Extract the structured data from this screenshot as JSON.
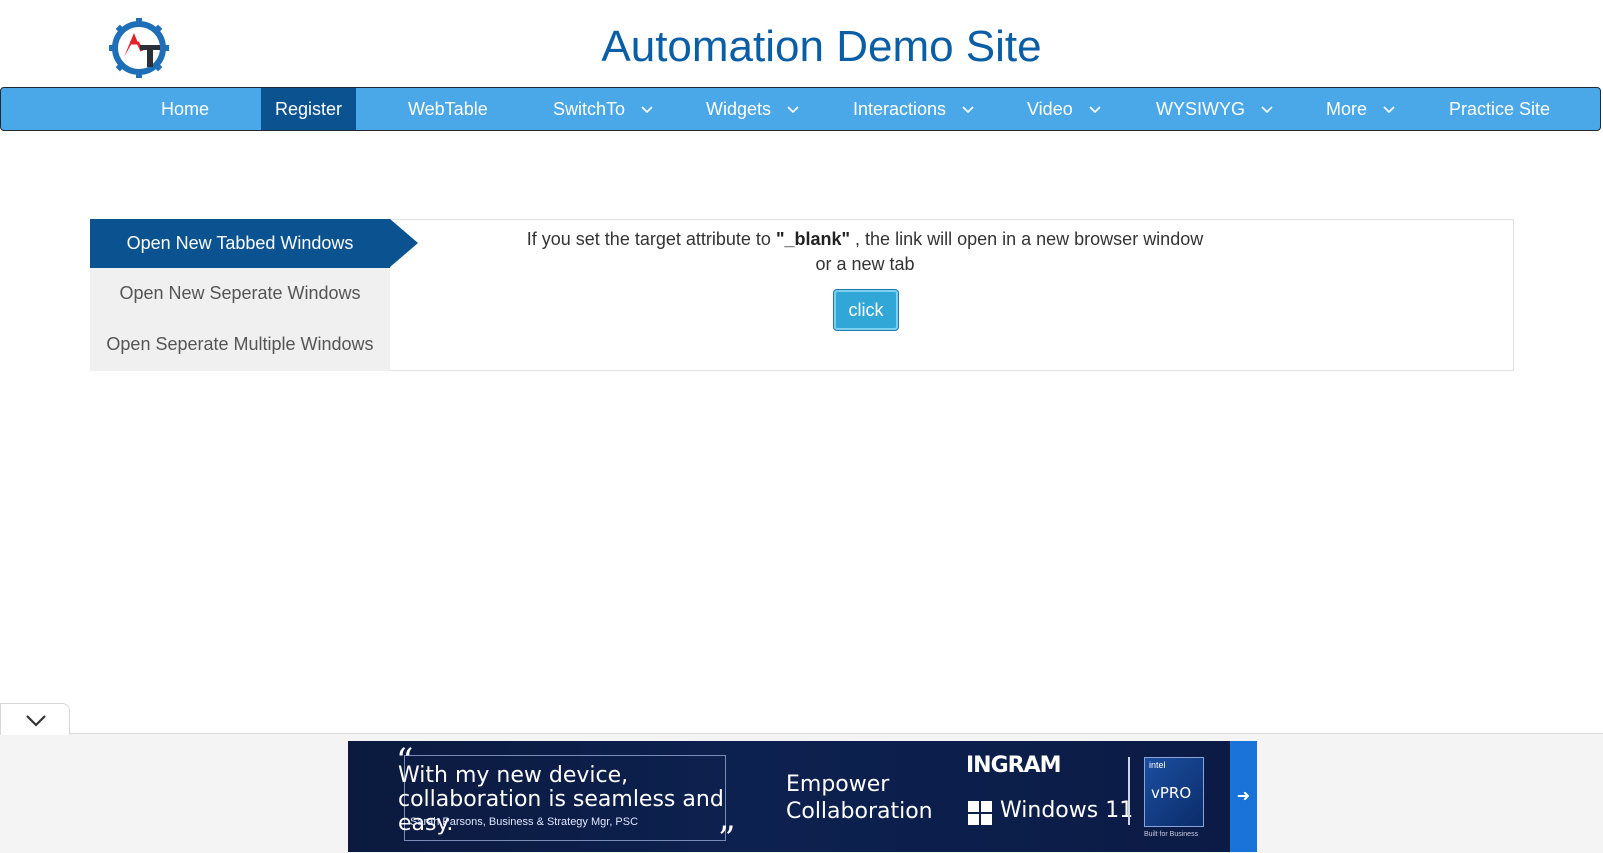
{
  "header": {
    "title": "Automation Demo Site",
    "logo_icon": "gear-logo-icon"
  },
  "nav": {
    "items": [
      {
        "label": "Home",
        "dropdown": false
      },
      {
        "label": "Register",
        "dropdown": false,
        "active": true
      },
      {
        "label": "WebTable",
        "dropdown": false
      },
      {
        "label": "SwitchTo",
        "dropdown": true
      },
      {
        "label": "Widgets",
        "dropdown": true
      },
      {
        "label": "Interactions",
        "dropdown": true
      },
      {
        "label": "Video",
        "dropdown": true
      },
      {
        "label": "WYSIWYG",
        "dropdown": true
      },
      {
        "label": "More",
        "dropdown": true
      },
      {
        "label": "Practice Site",
        "dropdown": false
      }
    ]
  },
  "tabs": {
    "items": [
      {
        "label": "Open New Tabbed Windows",
        "active": true
      },
      {
        "label": "Open New Seperate Windows"
      },
      {
        "label": "Open Seperate Multiple Windows"
      }
    ]
  },
  "content": {
    "desc_before": "If you set the target attribute to",
    "desc_bold": "\"_blank\"",
    "desc_after": ", the link will open in a new browser window or a new tab",
    "button_label": "click"
  },
  "ad": {
    "quote": "With my new device, collaboration is seamless and easy.",
    "attribution": "Sarah Parsons, Business & Strategy Mgr, PSC",
    "headline_line1": "Empower",
    "headline_line2": "Collaboration",
    "brand1": "INGRAM",
    "brand2": "Windows 11",
    "badge_top": "intel",
    "badge_main": "vPRO",
    "badge_bottom": "Built for Business",
    "open_quote": "“",
    "close_quote": "”"
  },
  "colors": {
    "nav_bg": "#4aa8e8",
    "nav_active": "#0a5290",
    "title": "#0a5ea6",
    "button": "#31a7d8"
  }
}
